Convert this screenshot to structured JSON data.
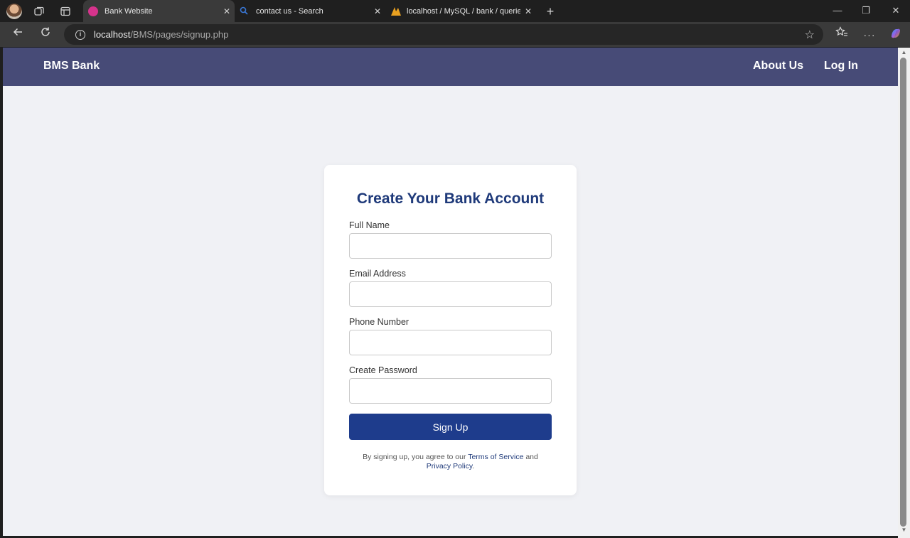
{
  "browser": {
    "tabs": [
      {
        "title": "Bank Website",
        "active": true,
        "favicon_color": "#d6338c"
      },
      {
        "title": "contact us - Search",
        "active": false,
        "favicon_color": "#3a78d6"
      },
      {
        "title": "localhost / MySQL / bank / querie",
        "active": false,
        "favicon_color": "#e8a020"
      }
    ],
    "url_host": "localhost",
    "url_path": "/BMS/pages/signup.php"
  },
  "navbar": {
    "brand": "BMS Bank",
    "links": [
      "About Us",
      "Log In"
    ]
  },
  "form": {
    "title": "Create Your Bank Account",
    "fields": [
      {
        "label": "Full Name",
        "value": ""
      },
      {
        "label": "Email Address",
        "value": ""
      },
      {
        "label": "Phone Number",
        "value": ""
      },
      {
        "label": "Create Password",
        "value": ""
      }
    ],
    "submit_label": "Sign Up",
    "legal_prefix": "By signing up, you agree to our",
    "terms_link": "Terms of Service",
    "legal_and": "and",
    "privacy_link": "Privacy Policy",
    "legal_suffix": "."
  },
  "colors": {
    "navbar": "#474b77",
    "primary": "#1e3c8c",
    "page_bg": "#f0f1f5"
  }
}
